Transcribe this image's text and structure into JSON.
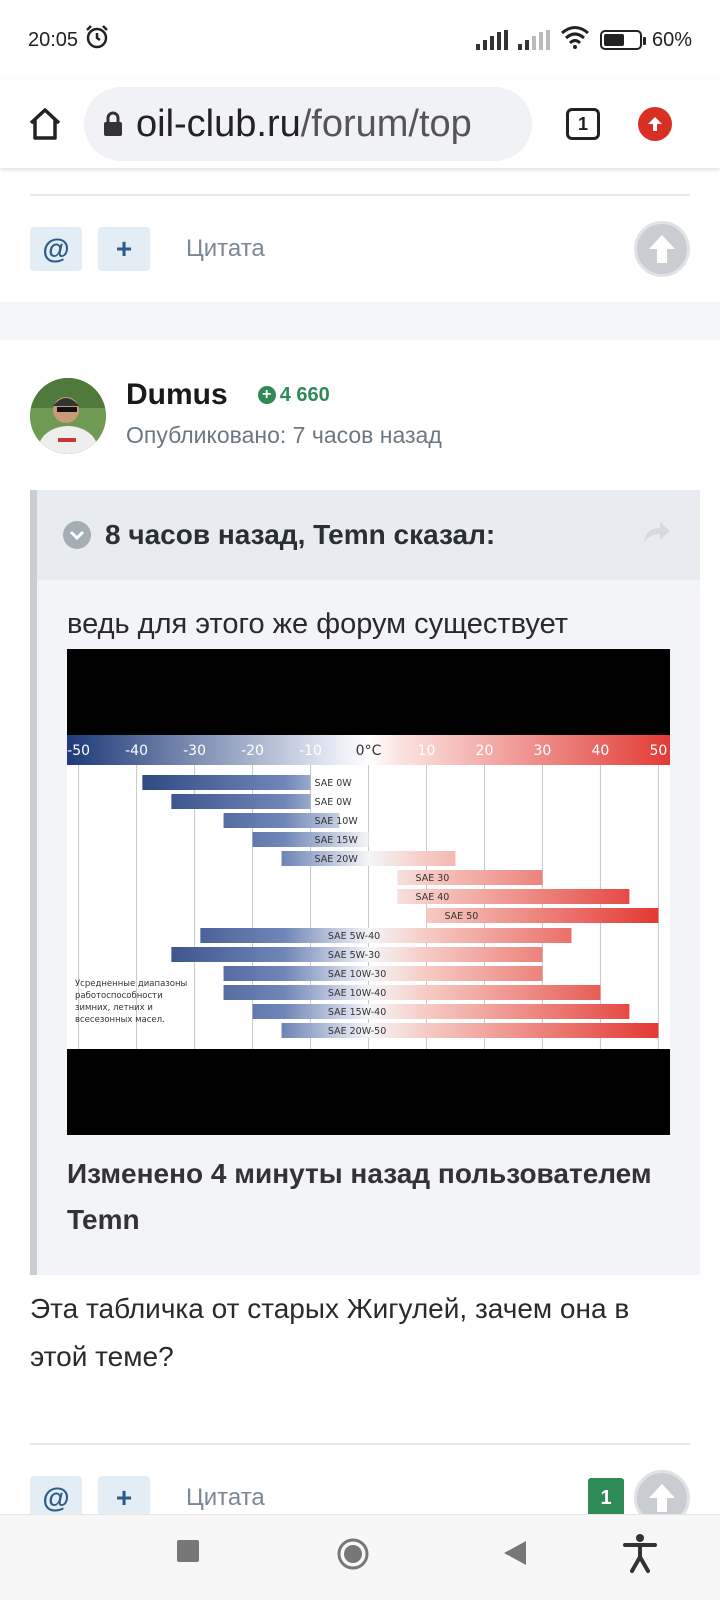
{
  "status_bar": {
    "time": "20:05",
    "battery": "60%",
    "battery_level": 0.6
  },
  "browser": {
    "url_domain": "oil-club.ru",
    "url_path": "/forum/top",
    "tab_count": "1"
  },
  "top_actions": {
    "mention": "@",
    "plus": "+",
    "quote": "Цитата"
  },
  "post": {
    "author": "Dumus",
    "reputation": "4 660",
    "posted": "Опубликовано: 7 часов назад",
    "quote": {
      "header": "8 часов назад, Temn сказал:",
      "text": "ведь для этого же форум существует",
      "edited": "Изменено 4 минуты назад пользователем Temn"
    },
    "text": "Эта табличка от старых Жигулей, зачем она в этой теме?",
    "actions": {
      "mention": "@",
      "plus": "+",
      "quote": "Цитата",
      "reactions_count": "1"
    }
  },
  "chart_data": {
    "type": "bar",
    "orientation": "horizontal-range",
    "x_ticks": [
      "-50",
      "-40",
      "-30",
      "-20",
      "-10",
      "0°C",
      "10",
      "20",
      "30",
      "40",
      "50"
    ],
    "xlim": [
      -52,
      52
    ],
    "series": [
      {
        "label": "SAE 0W",
        "from": -39,
        "to": -10
      },
      {
        "label": "SAE 0W",
        "from": -34,
        "to": -10
      },
      {
        "label": "SAE 10W",
        "from": -25,
        "to": -5
      },
      {
        "label": "SAE 15W",
        "from": -20,
        "to": 0
      },
      {
        "label": "SAE 20W",
        "from": -15,
        "to": 15
      },
      {
        "label": "SAE 30",
        "from": 5,
        "to": 30
      },
      {
        "label": "SAE 40",
        "from": 5,
        "to": 45
      },
      {
        "label": "SAE 50",
        "from": 10,
        "to": 50
      },
      {
        "label": "SAE 5W-40",
        "from": -29,
        "to": 35
      },
      {
        "label": "SAE 5W-30",
        "from": -34,
        "to": 30
      },
      {
        "label": "SAE 10W-30",
        "from": -25,
        "to": 30
      },
      {
        "label": "SAE 10W-40",
        "from": -25,
        "to": 40
      },
      {
        "label": "SAE 15W-40",
        "from": -20,
        "to": 45
      },
      {
        "label": "SAE 20W-50",
        "from": -15,
        "to": 50
      }
    ],
    "note": "Усредненные диапазоны работоспособности зимних, летних и всесезонных масел."
  }
}
